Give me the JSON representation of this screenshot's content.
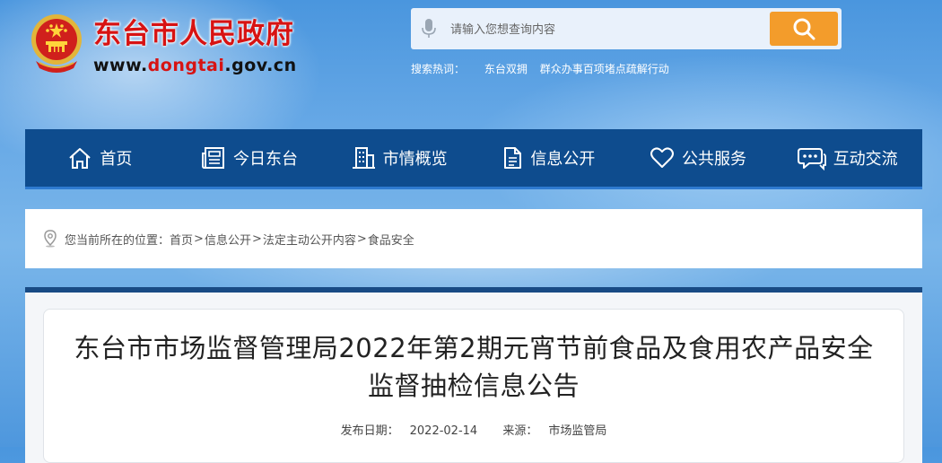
{
  "header": {
    "site_name": "东台市人民政府",
    "url_prefix": "www.",
    "url_highlight": "dongtai",
    "url_suffix": ".gov.cn",
    "emblem_icon": "national-emblem-icon"
  },
  "search": {
    "placeholder": "请输入您想查询内容",
    "hot_label": "搜索热词：",
    "hot_words": [
      "东台双拥",
      "群众办事百项堵点疏解行动"
    ]
  },
  "nav": {
    "items": [
      {
        "label": "首页",
        "icon": "home-icon"
      },
      {
        "label": "今日东台",
        "icon": "newspaper-icon"
      },
      {
        "label": "市情概览",
        "icon": "building-icon"
      },
      {
        "label": "信息公开",
        "icon": "document-icon"
      },
      {
        "label": "公共服务",
        "icon": "heart-icon"
      },
      {
        "label": "互动交流",
        "icon": "chat-icon"
      }
    ]
  },
  "breadcrumb": {
    "prefix": "您当前所在的位置：",
    "items": [
      "首页",
      "信息公开",
      "法定主动公开内容",
      "食品安全"
    ],
    "separator": ">"
  },
  "article": {
    "title": "东台市市场监督管理局2022年第2期元宵节前食品及食用农产品安全监督抽检信息公告",
    "date_label": "发布日期：",
    "date": "2022-02-14",
    "source_label": "来源：",
    "source": "市场监管局"
  },
  "colors": {
    "nav_bg": "#0e4c8e",
    "brand_red": "#d71313",
    "search_button": "#f39c2b"
  }
}
